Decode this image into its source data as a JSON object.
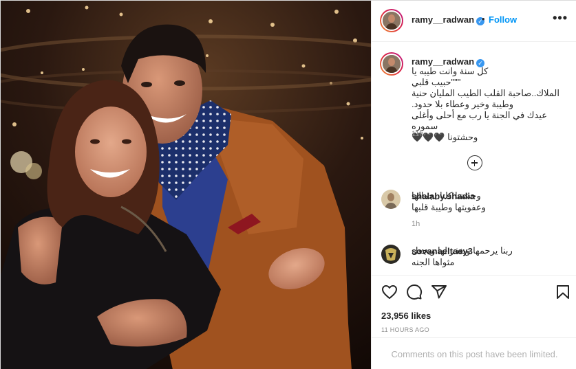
{
  "post": {
    "username": "ramy__radwan",
    "follow_label": "Follow",
    "separator": "•",
    "more_label": "•••",
    "verified_mark": "✓"
  },
  "caption": {
    "username": "ramy__radwan",
    "text": "كل سنة وانت طيبه يا\n\"\"\"حبيب قلبي\nالملاك..صاحبة القلب الطيب المليان حنية\nوطيبة وخير وعطاء بلا حدود.\nعيدك في الجنة يا رب مع أحلى وأغلى سموره\nوحشتونا 🖤🖤🖤",
    "time": "11h"
  },
  "comments": [
    {
      "username": "shalaby.shadia",
      "text": "وحشتنا كلنا بجمالها\nوعفويتها وطيبة قلبها",
      "time": "1h"
    },
    {
      "username": "sovanaeltaey3",
      "text": "ربنا يرحمها ويغفر لها ويجعل\nمثواها الجنه"
    }
  ],
  "icons": {
    "like": "heart-icon",
    "comment": "comment-icon",
    "share": "share-icon",
    "save": "bookmark-icon",
    "load_more": "plus-circle-icon"
  },
  "stats": {
    "likes": "23,956 likes",
    "time_ago": "11 HOURS AGO"
  },
  "footer": {
    "limited_text": "Comments on this post have been limited."
  },
  "colors": {
    "follow": "#0095f6",
    "verified": "#3897f0",
    "muted": "#8e8e8e"
  }
}
